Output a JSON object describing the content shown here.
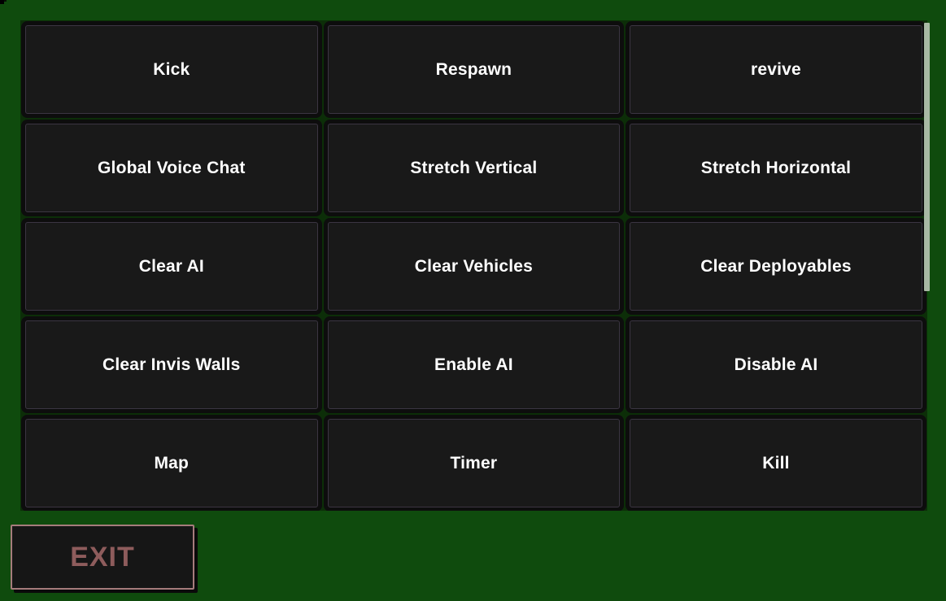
{
  "theme": {
    "background_green": "#0f4b0d",
    "panel_green": "#0c2e08",
    "tile_fill": "#191919",
    "tile_border": "#3b3542",
    "label_color": "#ffffff",
    "exit_border": "#a67c7c",
    "exit_text": "#8e5c5c",
    "scrollbar_thumb": "#a8b8a4"
  },
  "panel": {
    "name": "admin-command-menu",
    "scrollbar": {
      "icon": "vertical-scrollbar",
      "thumb_position_percent": 0,
      "thumb_size_percent": 55
    },
    "buttons": [
      {
        "label": "Kick"
      },
      {
        "label": "Respawn"
      },
      {
        "label": "revive"
      },
      {
        "label": "Global Voice Chat"
      },
      {
        "label": "Stretch Vertical"
      },
      {
        "label": "Stretch Horizontal"
      },
      {
        "label": "Clear AI"
      },
      {
        "label": "Clear Vehicles"
      },
      {
        "label": "Clear Deployables"
      },
      {
        "label": "Clear Invis Walls"
      },
      {
        "label": "Enable AI"
      },
      {
        "label": "Disable AI"
      },
      {
        "label": "Map"
      },
      {
        "label": "Timer"
      },
      {
        "label": "Kill"
      }
    ]
  },
  "footer": {
    "exit_label": "EXIT"
  }
}
